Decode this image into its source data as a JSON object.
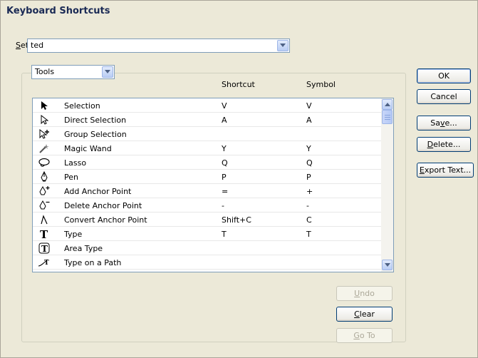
{
  "window": {
    "title": "Keyboard Shortcuts"
  },
  "set": {
    "label_key": "S",
    "label_rest": "et:",
    "value": "ted"
  },
  "category": {
    "value": "Tools"
  },
  "columns": {
    "shortcut": "Shortcut",
    "symbol": "Symbol"
  },
  "rows": [
    {
      "icon": "selection-arrow-icon",
      "name": "Selection",
      "shortcut": "V",
      "symbol": "V"
    },
    {
      "icon": "direct-selection-arrow-icon",
      "name": "Direct Selection",
      "shortcut": "A",
      "symbol": "A"
    },
    {
      "icon": "group-selection-arrow-icon",
      "name": "Group Selection",
      "shortcut": "",
      "symbol": ""
    },
    {
      "icon": "magic-wand-icon",
      "name": "Magic Wand",
      "shortcut": "Y",
      "symbol": "Y"
    },
    {
      "icon": "lasso-icon",
      "name": "Lasso",
      "shortcut": "Q",
      "symbol": "Q"
    },
    {
      "icon": "pen-icon",
      "name": "Pen",
      "shortcut": "P",
      "symbol": "P"
    },
    {
      "icon": "add-anchor-point-icon",
      "name": "Add Anchor Point",
      "shortcut": "=",
      "symbol": "+"
    },
    {
      "icon": "delete-anchor-point-icon",
      "name": "Delete Anchor Point",
      "shortcut": "-",
      "symbol": "-"
    },
    {
      "icon": "convert-anchor-point-icon",
      "name": "Convert Anchor Point",
      "shortcut": "Shift+C",
      "symbol": "C"
    },
    {
      "icon": "type-icon",
      "name": "Type",
      "shortcut": "T",
      "symbol": "T"
    },
    {
      "icon": "area-type-icon",
      "name": "Area Type",
      "shortcut": "",
      "symbol": ""
    },
    {
      "icon": "type-on-path-icon",
      "name": "Type on a Path",
      "shortcut": "",
      "symbol": ""
    }
  ],
  "buttons": {
    "ok": "OK",
    "cancel": "Cancel",
    "save": {
      "pre": "Sa",
      "key": "v",
      "post": "e..."
    },
    "delete": {
      "pre": "",
      "key": "D",
      "post": "elete..."
    },
    "export": {
      "pre": "",
      "key": "E",
      "post": "xport Text..."
    },
    "undo": {
      "pre": "",
      "key": "U",
      "post": "ndo"
    },
    "clear": {
      "pre": "",
      "key": "C",
      "post": "lear"
    },
    "goto": {
      "pre": "",
      "key": "G",
      "post": "o To"
    }
  }
}
